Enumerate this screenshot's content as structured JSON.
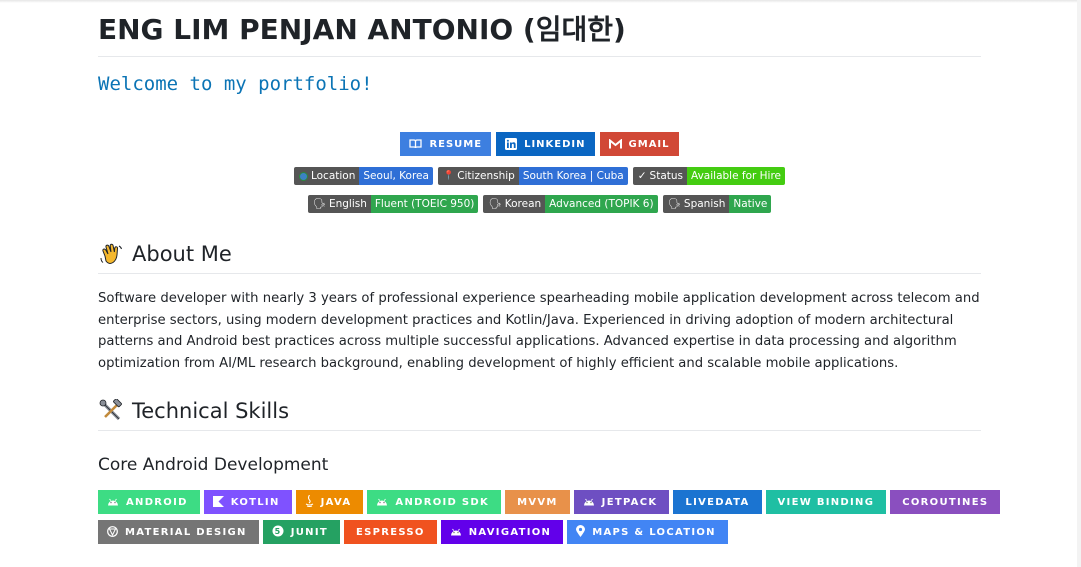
{
  "header": {
    "title": "ENG LIM PENJAN ANTONIO (임대한)"
  },
  "welcome": "Welcome to my portfolio!",
  "links": [
    {
      "label": "RESUME",
      "icon": "book-icon",
      "color": "#3d7fe0"
    },
    {
      "label": "LINKEDIN",
      "icon": "linkedin-icon",
      "color": "#0a66c2"
    },
    {
      "label": "GMAIL",
      "icon": "gmail-icon",
      "color": "#d14836"
    }
  ],
  "info_badges": [
    {
      "label": "Location",
      "value": "Seoul, Korea",
      "icon": "globe-icon",
      "color": "#2f6fd6"
    },
    {
      "label": "Citizenship",
      "value": "South Korea | Cuba",
      "icon": "pin-icon",
      "color": "#2f6fd6"
    },
    {
      "label": "Status",
      "value": "Available for Hire",
      "icon": "check-icon",
      "color": "#44cc11"
    }
  ],
  "language_badges": [
    {
      "label": "English",
      "value": "Fluent (TOEIC 950)",
      "color": "#2fa64e"
    },
    {
      "label": "Korean",
      "value": "Advanced (TOPIK 6)",
      "color": "#2fa64e"
    },
    {
      "label": "Spanish",
      "value": "Native",
      "color": "#2fa64e"
    }
  ],
  "about": {
    "heading": "About Me",
    "text": "Software developer with nearly 3 years of professional experience spearheading mobile application development across telecom and enterprise sectors, using modern development practices and Kotlin/Java. Experienced in driving adoption of modern architectural patterns and Android best practices across multiple successful applications. Advanced expertise in data processing and algorithm optimization from AI/ML research background, enabling development of highly efficient and scalable mobile applications."
  },
  "skills": {
    "heading": "Technical Skills",
    "subheading": "Core Android Development",
    "row1": [
      {
        "label": "ANDROID",
        "icon": "android-icon",
        "color": "#3ddc84"
      },
      {
        "label": "KOTLIN",
        "icon": "kotlin-icon",
        "color": "#7f52ff"
      },
      {
        "label": "JAVA",
        "icon": "java-icon",
        "color": "#ed8b00"
      },
      {
        "label": "ANDROID SDK",
        "icon": "android-icon",
        "color": "#3ddc84"
      },
      {
        "label": "MVVM",
        "icon": "",
        "color": "#e8914a"
      },
      {
        "label": "JETPACK",
        "icon": "android-icon",
        "color": "#6e4fc2"
      },
      {
        "label": "LIVEDATA",
        "icon": "",
        "color": "#1b74d1"
      },
      {
        "label": "VIEW BINDING",
        "icon": "",
        "color": "#1fbfa3"
      },
      {
        "label": "COROUTINES",
        "icon": "",
        "color": "#8a4fbf"
      }
    ],
    "row2": [
      {
        "label": "MATERIAL DESIGN",
        "icon": "material-icon",
        "color": "#757575"
      },
      {
        "label": "JUNIT",
        "icon": "junit-icon",
        "color": "#25a162"
      },
      {
        "label": "ESPRESSO",
        "icon": "",
        "color": "#f0521f"
      },
      {
        "label": "NAVIGATION",
        "icon": "android-icon",
        "color": "#6200ea"
      },
      {
        "label": "MAPS & LOCATION",
        "icon": "map-pin-icon",
        "color": "#4285f4"
      }
    ]
  }
}
